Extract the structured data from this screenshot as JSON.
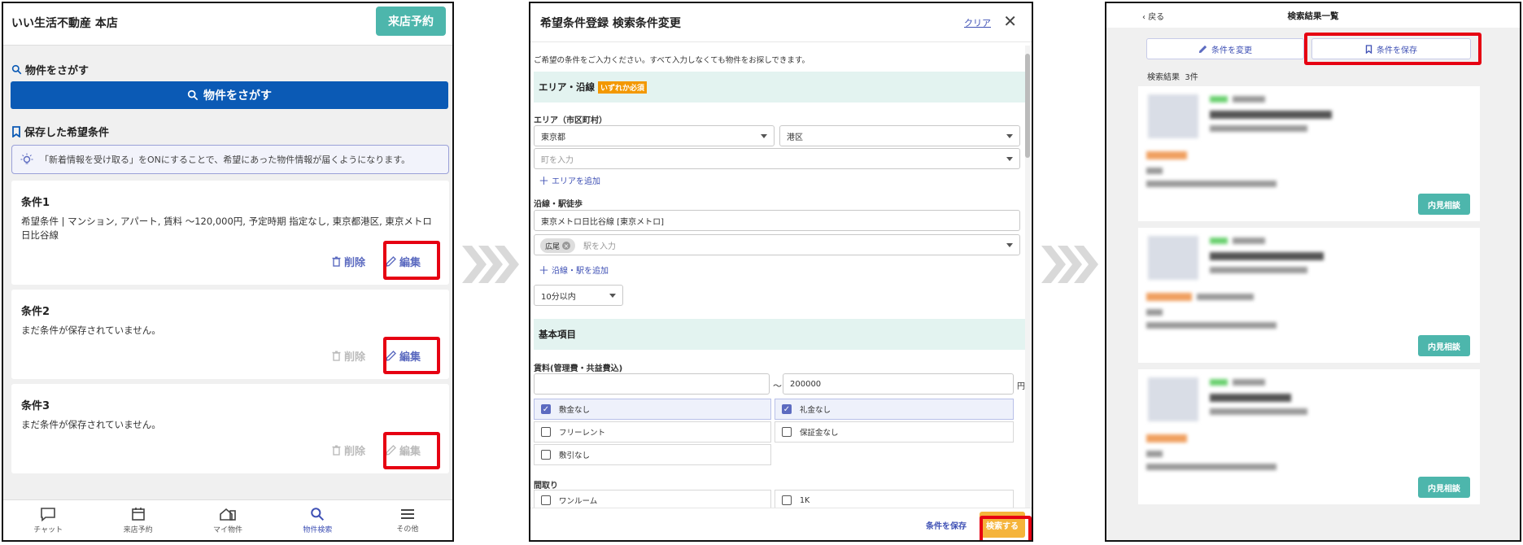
{
  "panel1": {
    "header": {
      "title": "いい生活不動産 本店",
      "reserve_button": "来店予約"
    },
    "search_section": {
      "heading": "物件をさがす",
      "button": "物件をさがす"
    },
    "saved_section": {
      "heading": "保存した希望条件"
    },
    "info_text": "「新着情報を受け取る」をONにすることで、希望にあった物件情報が届くようになります。",
    "cards": [
      {
        "title": "条件1",
        "body": "希望条件 | マンション, アパート, 賃料 〜120,000円, 予定時期 指定なし, 東京都港区, 東京メトロ日比谷線",
        "delete": "削除",
        "edit": "編集"
      },
      {
        "title": "条件2",
        "body": "まだ条件が保存されていません。",
        "delete": "削除",
        "edit": "編集"
      },
      {
        "title": "条件3",
        "body": "まだ条件が保存されていません。",
        "delete": "削除",
        "edit": "編集"
      }
    ],
    "nav": [
      {
        "label": "チャット",
        "icon": "chat-icon"
      },
      {
        "label": "来店予約",
        "icon": "calendar-icon"
      },
      {
        "label": "マイ物件",
        "icon": "home-icon"
      },
      {
        "label": "物件検索",
        "icon": "search-icon"
      },
      {
        "label": "その他",
        "icon": "menu-icon"
      }
    ]
  },
  "panel2": {
    "title": "希望条件登録 検索条件変更",
    "clear": "クリア",
    "intro": "ご希望の条件をご入力ください。すべて入力しなくても物件をお探しできます。",
    "area_band": "エリア・沿線",
    "area_tag": "いずれか必須",
    "area_label": "エリア（市区町村）",
    "pref_value": "東京都",
    "city_value": "港区",
    "town_placeholder": "町を入力",
    "add_area": "エリアを追加",
    "line_label": "沿線・駅徒歩",
    "line_value": "東京メトロ日比谷線 [東京メトロ]",
    "station_chip": "広尾",
    "station_placeholder": "駅を入力",
    "add_line": "沿線・駅を追加",
    "walk_value": "10分以内",
    "basic_band": "基本項目",
    "rent_label": "賃料(管理費・共益費込)",
    "rent_sep": "〜",
    "rent_max": "200000",
    "rent_unit": "円",
    "checks": {
      "no_deposit": "敷金なし",
      "no_key_money": "礼金なし",
      "free_rent": "フリーレント",
      "no_guarantee": "保証金なし",
      "no_shikibiki": "敷引なし"
    },
    "layout_label": "間取り",
    "layout": {
      "one_room": "ワンルーム",
      "one_k": "1K"
    },
    "save": "条件を保存",
    "search": "検索する"
  },
  "panel3": {
    "back": "戻る",
    "title": "検索結果一覧",
    "change_button": "条件を変更",
    "save_button": "条件を保存",
    "result_label": "検索結果",
    "result_count": "3件",
    "view_button": "内見相談"
  }
}
